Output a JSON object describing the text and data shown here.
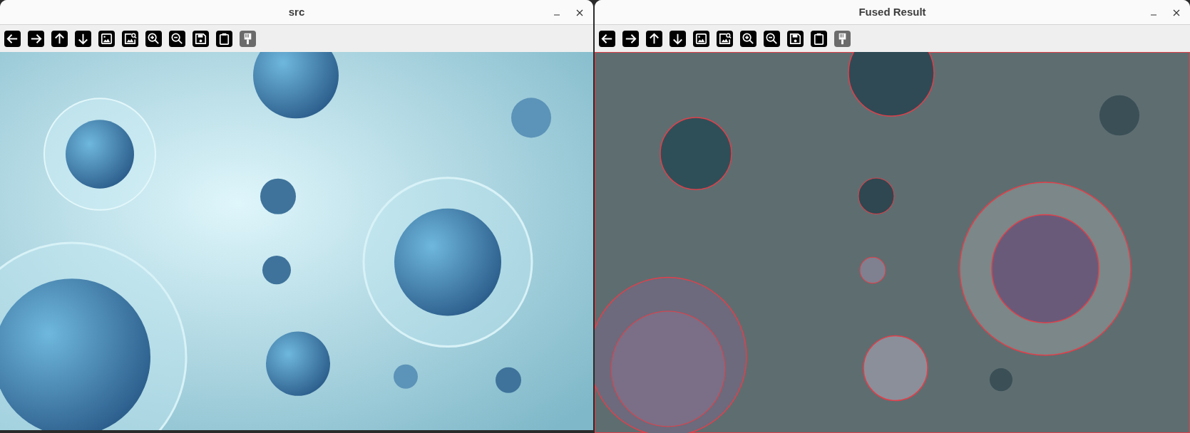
{
  "windows": [
    {
      "title": "src",
      "toolbar": [
        {
          "disabled": false
        },
        {
          "disabled": false
        },
        {
          "disabled": false
        },
        {
          "disabled": false
        },
        {
          "disabled": false
        },
        {
          "disabled": false
        },
        {
          "disabled": false
        },
        {
          "disabled": false
        },
        {
          "disabled": false
        },
        {
          "disabled": false
        },
        {
          "disabled": true
        }
      ]
    },
    {
      "title": "Fused Result",
      "toolbar": [
        {
          "disabled": false
        },
        {
          "disabled": false
        },
        {
          "disabled": false
        },
        {
          "disabled": false
        },
        {
          "disabled": false
        },
        {
          "disabled": false
        },
        {
          "disabled": false
        },
        {
          "disabled": false
        },
        {
          "disabled": false
        },
        {
          "disabled": false
        },
        {
          "disabled": true
        }
      ]
    }
  ]
}
